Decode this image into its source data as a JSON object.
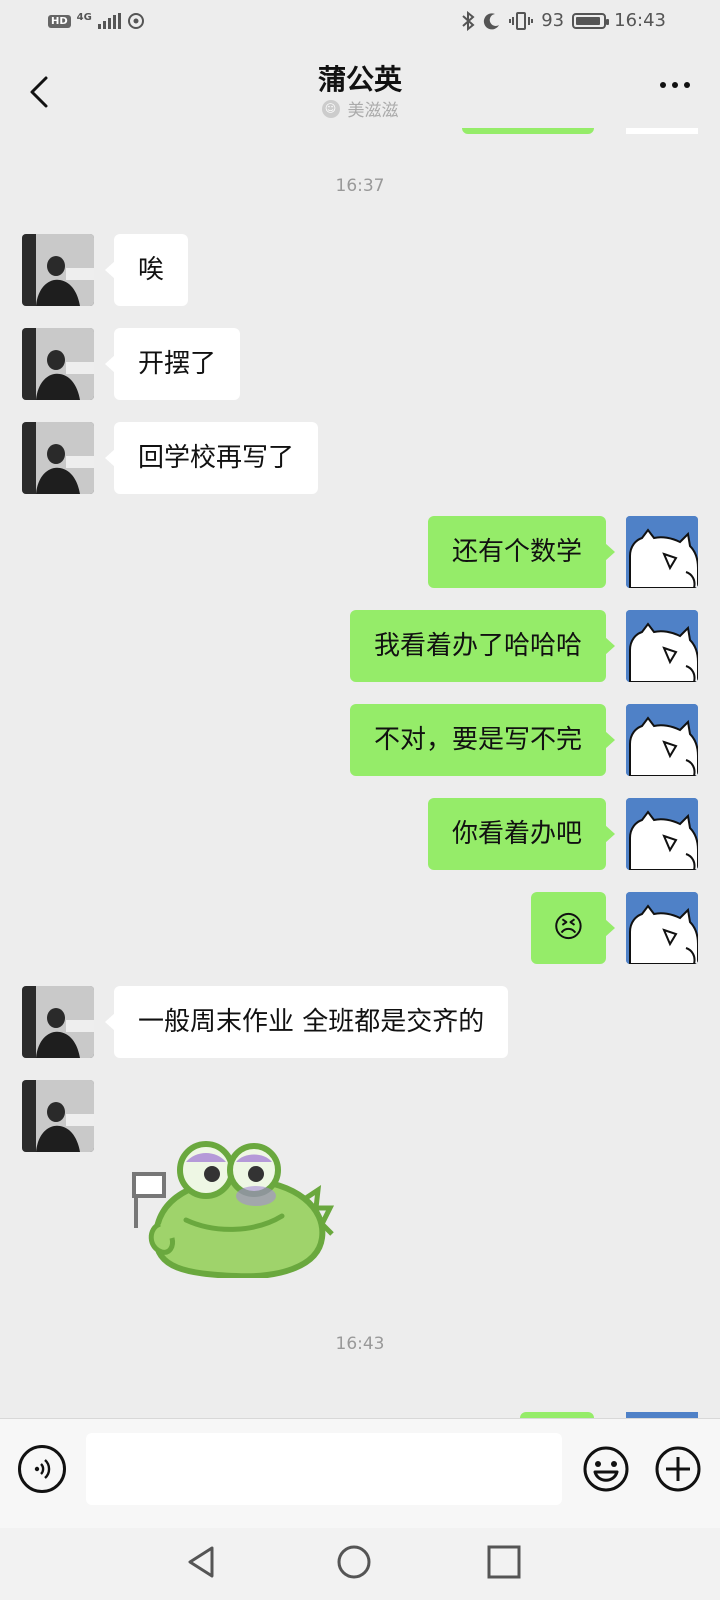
{
  "status_bar": {
    "left_badge": "HD",
    "network": "4G",
    "battery_text": "93",
    "battery_level": 0.93,
    "time": "16:43"
  },
  "header": {
    "title": "蒲公英",
    "subtitle": "美滋滋"
  },
  "conversation": {
    "time_markers": [
      "16:37",
      "16:43"
    ],
    "messages": [
      {
        "side": "in",
        "text": "唉"
      },
      {
        "side": "in",
        "text": "开摆了"
      },
      {
        "side": "in",
        "text": "回学校再写了"
      },
      {
        "side": "out",
        "text": "还有个数学"
      },
      {
        "side": "out",
        "text": "我看着办了哈哈哈"
      },
      {
        "side": "out",
        "text": "不对，要是写不完"
      },
      {
        "side": "out",
        "text": "你看着办吧"
      },
      {
        "side": "out",
        "text": "😣"
      },
      {
        "side": "in",
        "text": "一般周末作业 全班都是交齐的"
      },
      {
        "side": "in",
        "type": "sticker",
        "sticker": "frog-white-flag"
      }
    ]
  },
  "input_bar": {
    "placeholder": "",
    "value": ""
  },
  "colors": {
    "background": "#ededed",
    "incoming_bubble": "#ffffff",
    "outgoing_bubble": "#95ec69",
    "right_avatar": "#4f81c7"
  },
  "icons": [
    "back-arrow-icon",
    "more-icon",
    "voice-icon",
    "emoji-icon",
    "plus-icon",
    "nav-back-icon",
    "nav-home-icon",
    "nav-recents-icon"
  ]
}
